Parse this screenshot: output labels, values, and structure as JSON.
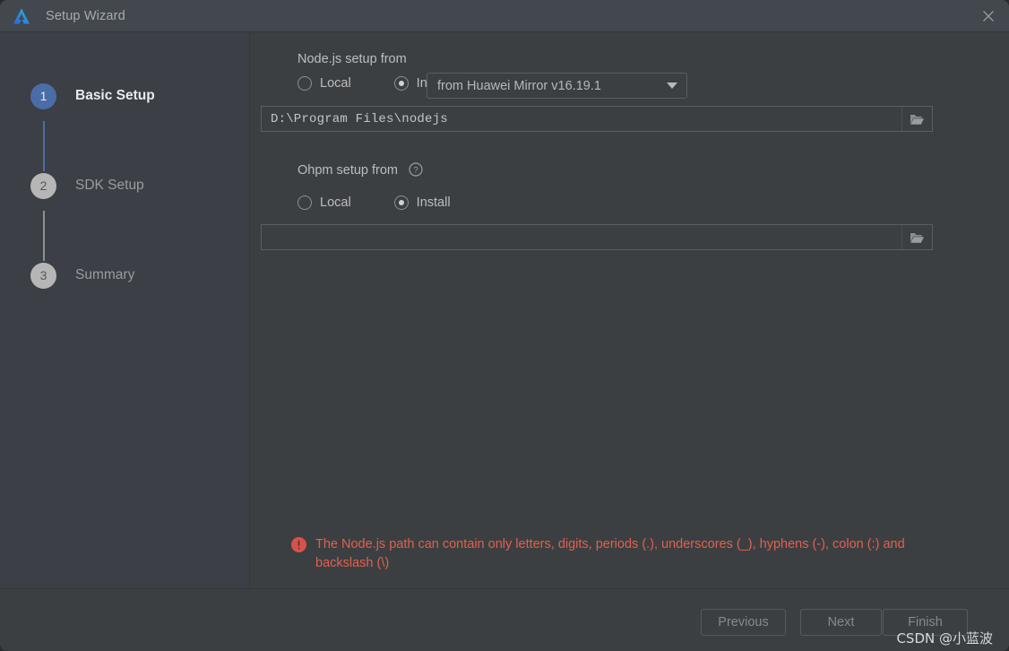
{
  "window": {
    "title": "Setup Wizard",
    "logo_icon": "deveco-logo-icon",
    "close_icon": "close-icon"
  },
  "sidebar": {
    "steps": [
      {
        "number": "1",
        "label": "Basic Setup",
        "state": "active"
      },
      {
        "number": "2",
        "label": "SDK Setup",
        "state": "inactive"
      },
      {
        "number": "3",
        "label": "Summary",
        "state": "inactive"
      }
    ]
  },
  "main": {
    "nodejs": {
      "section_label": "Node.js setup from",
      "radios": [
        {
          "label": "Local",
          "selected": false
        },
        {
          "label": "Install",
          "selected": true
        }
      ],
      "mirror_select": {
        "value": "from Huawei Mirror v16.19.1",
        "caret_icon": "chevron-down-icon"
      },
      "path_field": {
        "value": "D:\\Program Files\\nodejs",
        "placeholder": "",
        "browse_icon": "folder-icon"
      }
    },
    "ohpm": {
      "section_label": "Ohpm setup from",
      "help_icon": "help-circle-icon",
      "radios": [
        {
          "label": "Local",
          "selected": false
        },
        {
          "label": "Install",
          "selected": true
        }
      ],
      "path_field": {
        "value": "",
        "placeholder": "",
        "browse_icon": "folder-icon"
      }
    },
    "error": {
      "icon": "error-circle-icon",
      "message": "The Node.js path can contain only letters, digits, periods (.), underscores (_), hyphens (-), colon (:) and backslash (\\)",
      "color": "#e1604f"
    }
  },
  "footer": {
    "previous_label": "Previous",
    "next_label": "Next",
    "finish_label": "Finish"
  },
  "watermark": {
    "text": "CSDN @小蓝波"
  },
  "colors": {
    "accent": "#4a6da7",
    "sidebar_bg": "#3c3f46",
    "panel_bg": "#3c3f41",
    "titlebar_bg": "#43474e",
    "error": "#e1604f"
  }
}
